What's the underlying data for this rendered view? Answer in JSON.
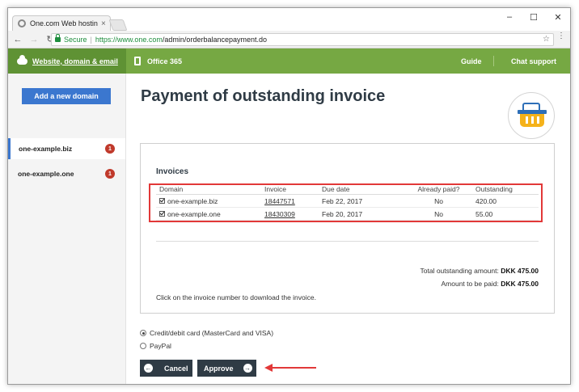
{
  "browser": {
    "tab_title": "One.com Web hosting",
    "tab_close": "×",
    "secure_label": "Secure",
    "url_scheme_host": "https://www.one.com",
    "url_path": "/admin/orderbalancepayment.do",
    "window_controls": {
      "minimize": "–",
      "maximize": "☐",
      "close": "✕"
    },
    "nav": {
      "back": "←",
      "forward": "→",
      "reload": "↻"
    }
  },
  "header": {
    "website_label": "Website, domain & email",
    "office_label": "Office 365",
    "guide_label": "Guide",
    "chat_label": "Chat support"
  },
  "sidebar": {
    "add_domain_label": "Add a new domain",
    "domains": [
      {
        "name": "one-example.biz",
        "badge": "1"
      },
      {
        "name": "one-example.one",
        "badge": "1"
      }
    ]
  },
  "page": {
    "title": "Payment of outstanding invoice"
  },
  "invoices": {
    "heading": "Invoices",
    "columns": [
      "Domain",
      "Invoice",
      "Due date",
      "Already paid?",
      "Outstanding"
    ],
    "rows": [
      {
        "domain": "one-example.biz",
        "invoice": "18447571",
        "due": "Feb 22, 2017",
        "paid": "No",
        "outstanding": "420.00"
      },
      {
        "domain": "one-example.one",
        "invoice": "18430309",
        "due": "Feb 20, 2017",
        "paid": "No",
        "outstanding": "55.00"
      }
    ],
    "total_label": "Total outstanding amount:",
    "total_value": "DKK 475.00",
    "topay_label": "Amount to be paid:",
    "topay_value": "DKK 475.00",
    "hint": "Click on the invoice number to download the invoice."
  },
  "payment": {
    "option_card": "Credit/debit card (MasterCard and VISA)",
    "option_paypal": "PayPal",
    "selected": "card"
  },
  "actions": {
    "cancel_label": "Cancel",
    "approve_label": "Approve"
  },
  "colors": {
    "header_green": "#76a843",
    "sidebar_green": "#5f9234",
    "button_dark": "#2f3b45",
    "primary_blue": "#3b77cf",
    "highlight_red": "#e23838"
  }
}
